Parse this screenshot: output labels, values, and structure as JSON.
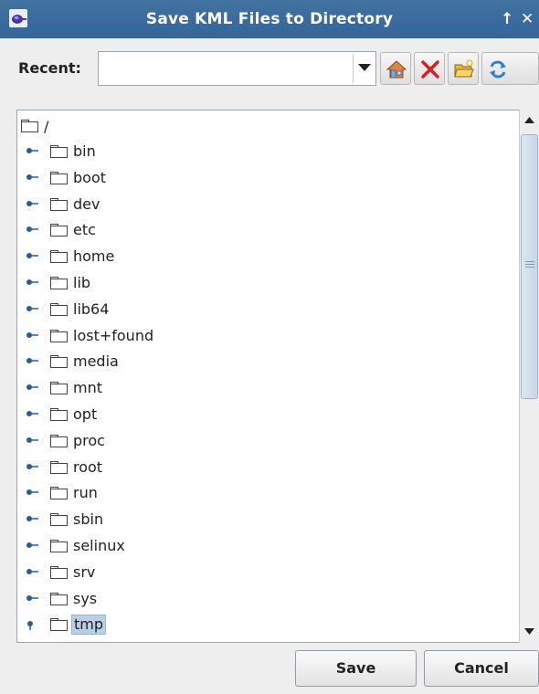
{
  "window": {
    "title": "Save KML Files to Directory",
    "up_symbol": "↑",
    "close_symbol": "✕",
    "app_icon": "java-app-icon"
  },
  "toolbar": {
    "recent_label": "Recent:",
    "recent_value": "",
    "buttons": [
      {
        "icon": "home-icon",
        "title": "Home"
      },
      {
        "icon": "delete-icon",
        "title": "Delete"
      },
      {
        "icon": "new-folder-icon",
        "title": "New Folder"
      },
      {
        "icon": "refresh-icon",
        "title": "Refresh"
      }
    ]
  },
  "tree": {
    "root": "/",
    "items": [
      {
        "label": "bin"
      },
      {
        "label": "boot"
      },
      {
        "label": "dev"
      },
      {
        "label": "etc"
      },
      {
        "label": "home"
      },
      {
        "label": "lib"
      },
      {
        "label": "lib64"
      },
      {
        "label": "lost+found"
      },
      {
        "label": "media"
      },
      {
        "label": "mnt"
      },
      {
        "label": "opt"
      },
      {
        "label": "proc"
      },
      {
        "label": "root"
      },
      {
        "label": "run"
      },
      {
        "label": "sbin"
      },
      {
        "label": "selinux"
      },
      {
        "label": "srv"
      },
      {
        "label": "sys"
      },
      {
        "label": "tmp",
        "selected": true
      }
    ]
  },
  "buttons": {
    "save": "Save",
    "cancel": "Cancel"
  },
  "colors": {
    "titlebar": "#3c6c9c",
    "selection": "#b8cfe5"
  }
}
